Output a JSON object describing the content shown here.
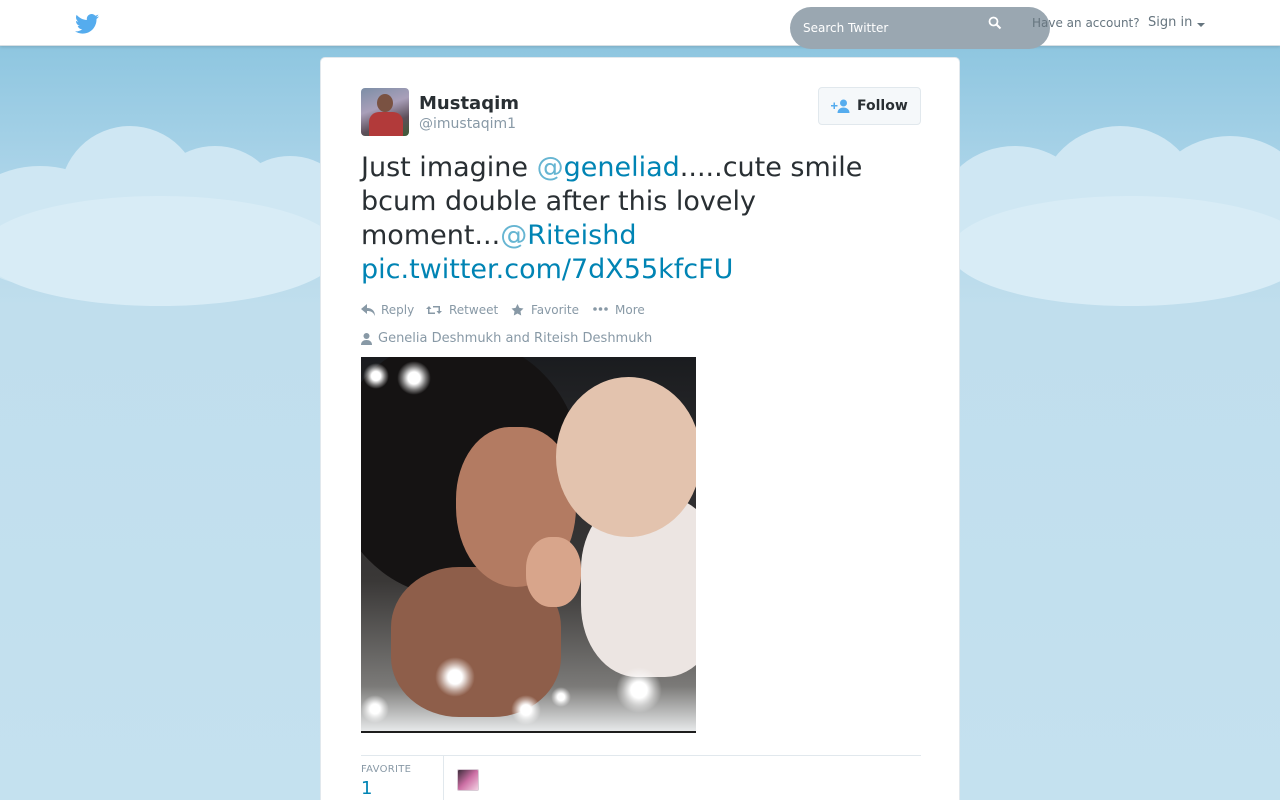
{
  "topbar": {
    "search_placeholder": "Search Twitter",
    "have_account": "Have an account?",
    "sign_in": "Sign in"
  },
  "tweet": {
    "fullname": "Mustaqim",
    "username": "@imustaqim1",
    "follow_label": "Follow",
    "text_parts": {
      "p1": "Just imagine ",
      "mention1_at": "@",
      "mention1": "geneliad",
      "p2": ".....cute smile bcum double after this lovely moment...",
      "mention2_at": "@",
      "mention2": "Riteishd",
      "link": "pic.twitter.com/7dX55kfcFU"
    },
    "actions": {
      "reply": "Reply",
      "retweet": "Retweet",
      "favorite": "Favorite",
      "more": "More"
    },
    "tagged_people": "Genelia Deshmukh and Riteish Deshmukh",
    "stats": {
      "favorite_label": "FAVORITE",
      "favorite_count": "1"
    }
  },
  "colors": {
    "link": "#0084b4",
    "text": "#292f33",
    "muted": "#8899a6",
    "brand": "#55acee"
  },
  "icons": [
    "twitter-bird-icon",
    "search-icon",
    "caret-down-icon",
    "follow-user-icon",
    "reply-icon",
    "retweet-icon",
    "star-icon",
    "more-icon",
    "person-icon"
  ]
}
